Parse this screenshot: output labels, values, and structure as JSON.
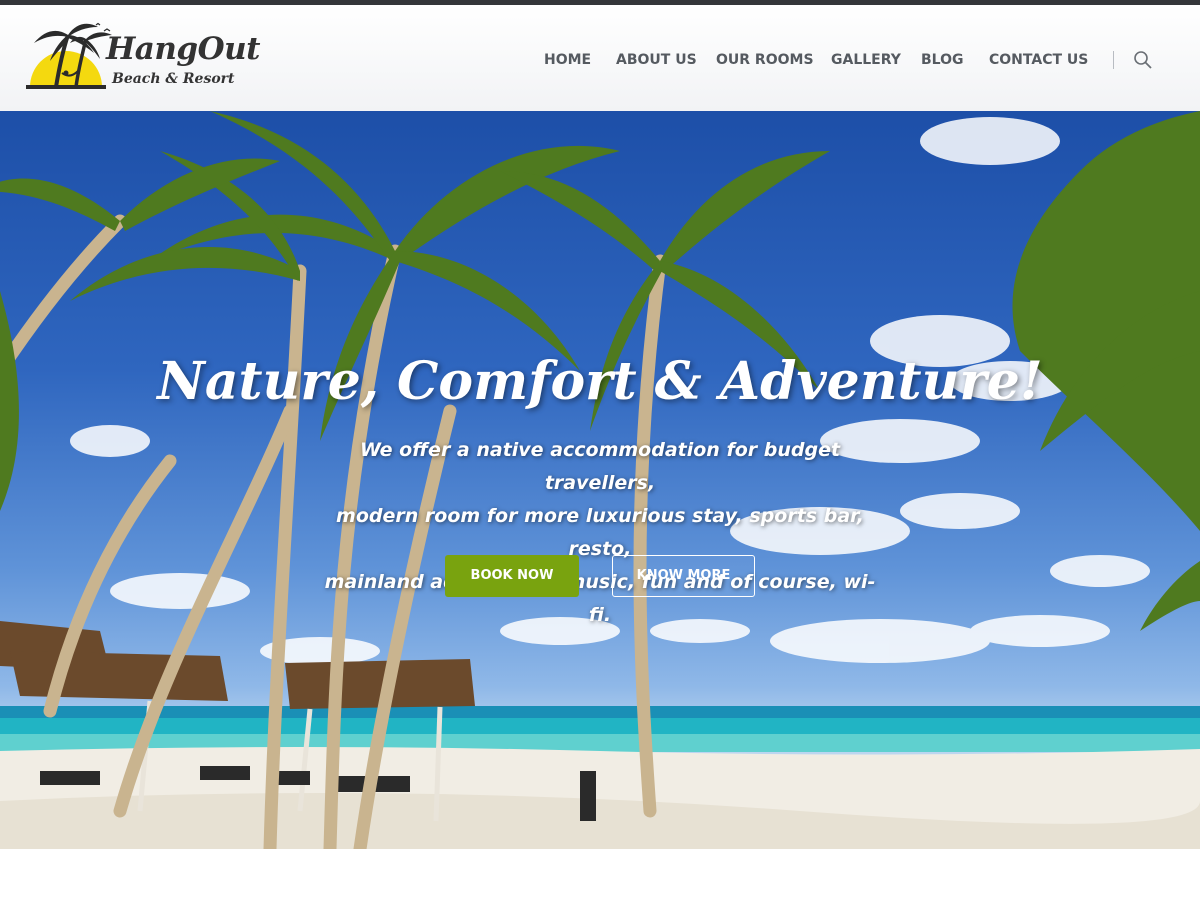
{
  "brand": {
    "name": "HangOut",
    "tagline": "Beach & Resort",
    "colors": {
      "accent_green": "#79a30f",
      "sun_yellow": "#f4d90f",
      "dark": "#35373a"
    }
  },
  "nav": {
    "items": [
      {
        "label": "HOME"
      },
      {
        "label": "ABOUT US"
      },
      {
        "label": "OUR ROOMS"
      },
      {
        "label": "GALLERY"
      },
      {
        "label": "BLOG"
      },
      {
        "label": "CONTACT US"
      }
    ],
    "search_icon": "search-icon"
  },
  "hero": {
    "title": "Nature, Comfort & Adventure!",
    "description_lines": [
      "We offer a native accommodation for budget travellers,",
      "modern room for more luxurious stay, sports bar, resto,",
      "mainland adventures, music, fun and of course, wi-fi."
    ],
    "primary_button": "BOOK NOW",
    "secondary_button": "KNOW MORE"
  }
}
